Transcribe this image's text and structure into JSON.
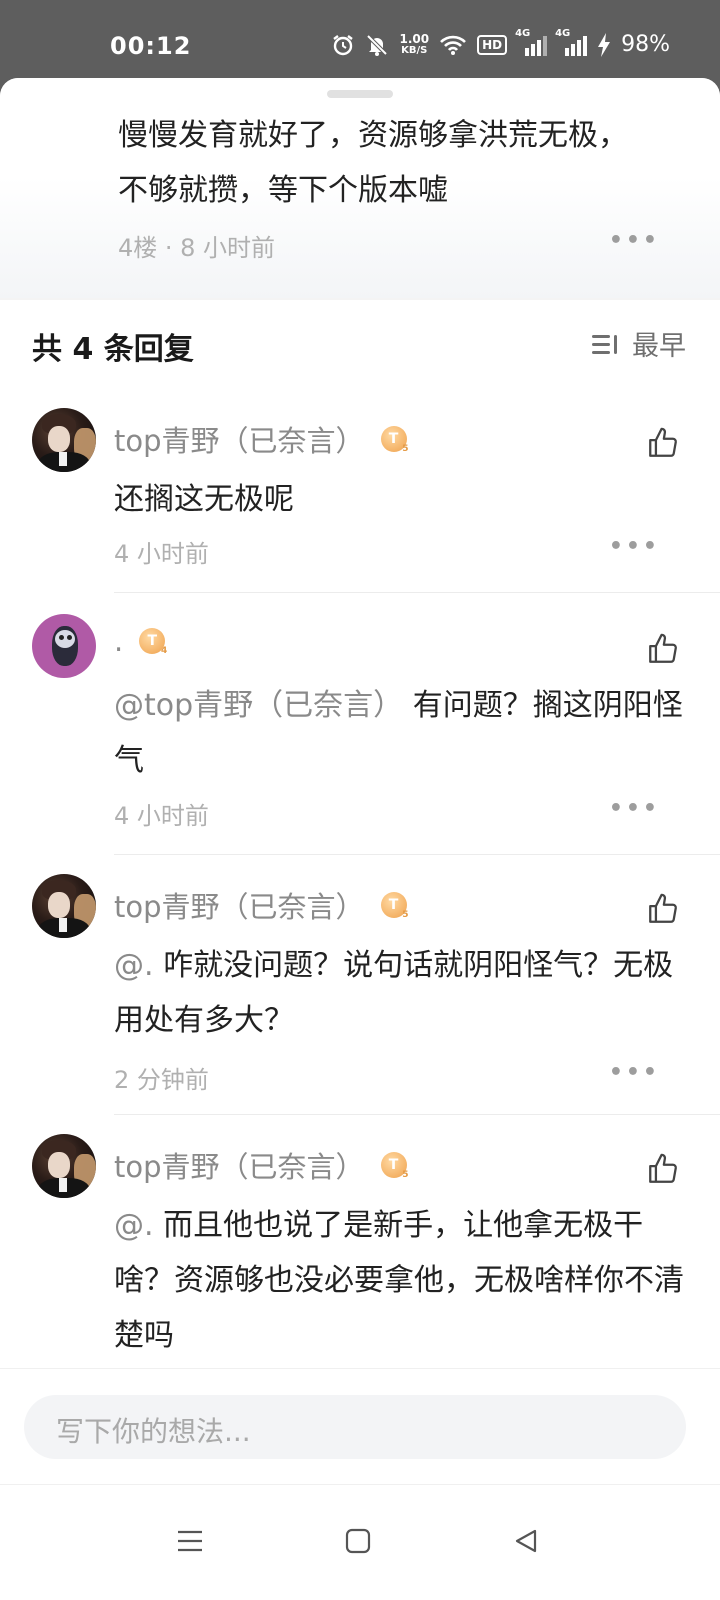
{
  "status_bar": {
    "time": "00:12",
    "net_speed_value": "1.00",
    "net_speed_unit": "KB/S",
    "hd_label": "HD",
    "signal1_label": "4G",
    "signal2_label": "4G",
    "battery": "98%"
  },
  "parent_comment": {
    "text_line1": "慢慢发育就好了，资源够拿洪荒无极，",
    "text_line2": "不够就攒，等下个版本嘘",
    "meta": "4楼 · 8 小时前"
  },
  "replies_header": {
    "count": "共 4 条回复",
    "sort_label": "最早"
  },
  "replies": [
    {
      "username": "top青野（已奈言）",
      "level": "T",
      "level_num": "5",
      "content": "还搁这无极呢",
      "mention": "",
      "time": "4 小时前"
    },
    {
      "username": ".",
      "level": "T",
      "level_num": "4",
      "mention": "@top青野（已奈言）",
      "content": "  有问题？搁这阴阳怪气",
      "time": "4 小时前"
    },
    {
      "username": "top青野（已奈言）",
      "level": "T",
      "level_num": "5",
      "mention": "@.",
      "content": "  咋就没问题？说句话就阴阳怪气？无极用处有多大？",
      "time": "2 分钟前"
    },
    {
      "username": "top青野（已奈言）",
      "level": "T",
      "level_num": "5",
      "mention": "@.",
      "content": "  而且他也说了是新手，让他拿无极干啥？资源够也没必要拿他，无极啥样你不清楚吗",
      "time": ""
    }
  ],
  "input": {
    "placeholder": "写下你的想法..."
  },
  "icons": {
    "alarm": "alarm-icon",
    "mute": "mute-icon",
    "wifi": "wifi-icon",
    "charging": "charging-icon",
    "sort": "sort-icon",
    "like": "thumbs-up-icon",
    "more": "more-icon",
    "nav_menu": "menu-icon",
    "nav_home": "home-icon",
    "nav_back": "back-icon"
  },
  "colors": {
    "status_bar_bg": "#5e5e5e",
    "badge": "#f4b266",
    "muted_text": "#8a8a8a"
  }
}
